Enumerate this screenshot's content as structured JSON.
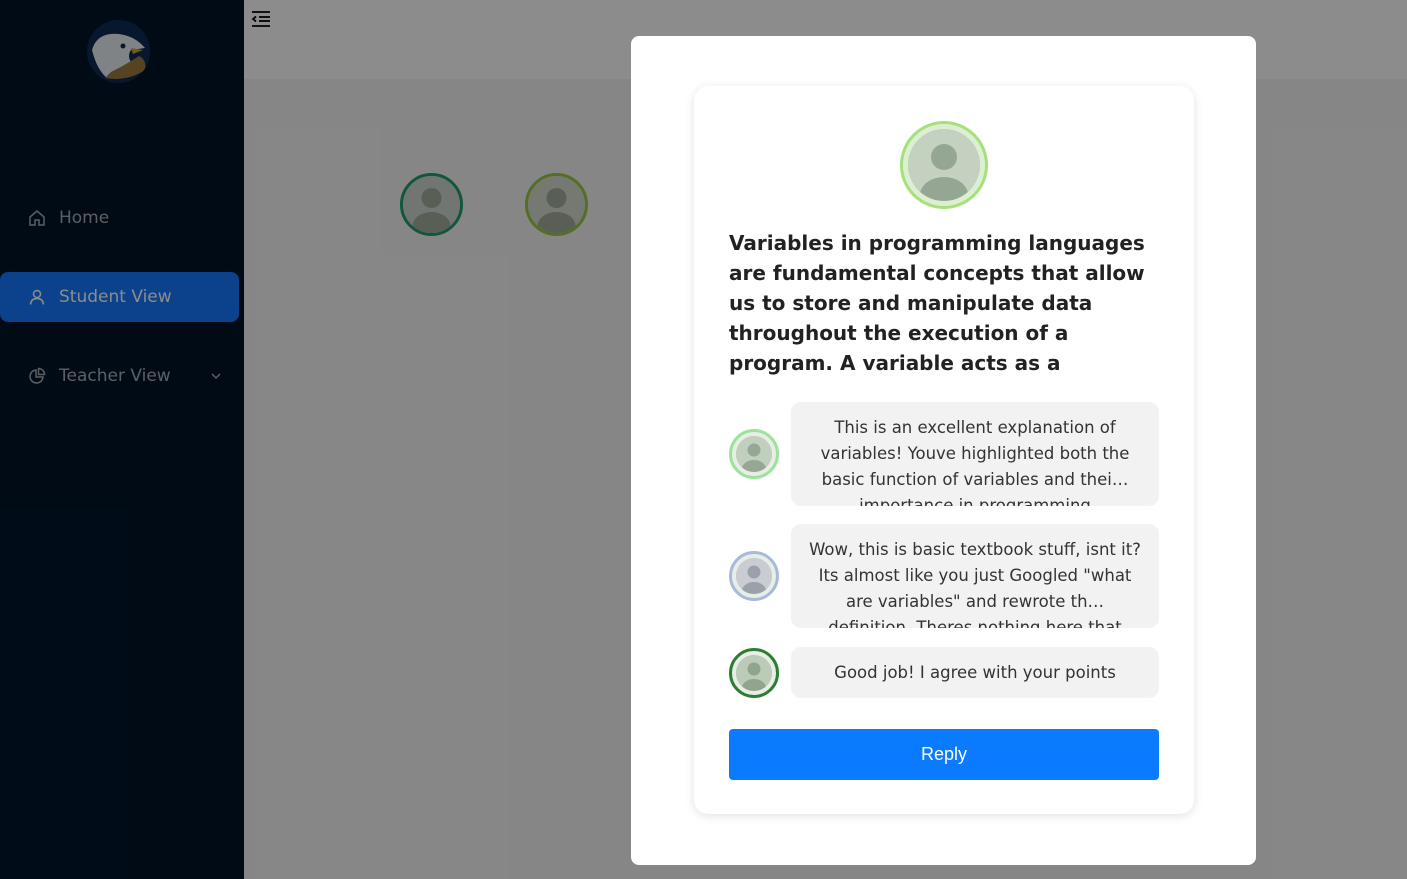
{
  "sidebar": {
    "logo_icon": "eagle-logo-icon",
    "items": [
      {
        "label": "Home",
        "icon": "home-icon"
      },
      {
        "label": "Student View",
        "icon": "user-icon",
        "active": true
      },
      {
        "label": "Teacher View",
        "icon": "pie-chart-icon"
      }
    ]
  },
  "header": {
    "collapse_icon": "menu-fold-icon"
  },
  "modal": {
    "post": {
      "text": "Variables in programming languages are fundamental concepts that allow us to store and manipulate data throughout the execution of a program. A variable acts as a symbolic name for…",
      "avatar_color": "#a6e07a"
    },
    "comments": [
      {
        "text": "This is an excellent explanation of variables! Youve highlighted both the basic function of variables and thei… importance in programming",
        "avatar_color": "#9be39b"
      },
      {
        "text": "Wow, this is basic textbook stuff, isnt it? Its almost like you just Googled \"what are variables\" and rewrote th… definition. Theres nothing here that",
        "avatar_color": "#a7bbd8"
      },
      {
        "text": "Good job! I agree with your points",
        "avatar_color": "#2e7d32"
      }
    ],
    "reply_label": "Reply"
  },
  "colors": {
    "sidebar_bg": "#001529",
    "accent": "#1677ff",
    "reply_button": "#0a7bff"
  }
}
